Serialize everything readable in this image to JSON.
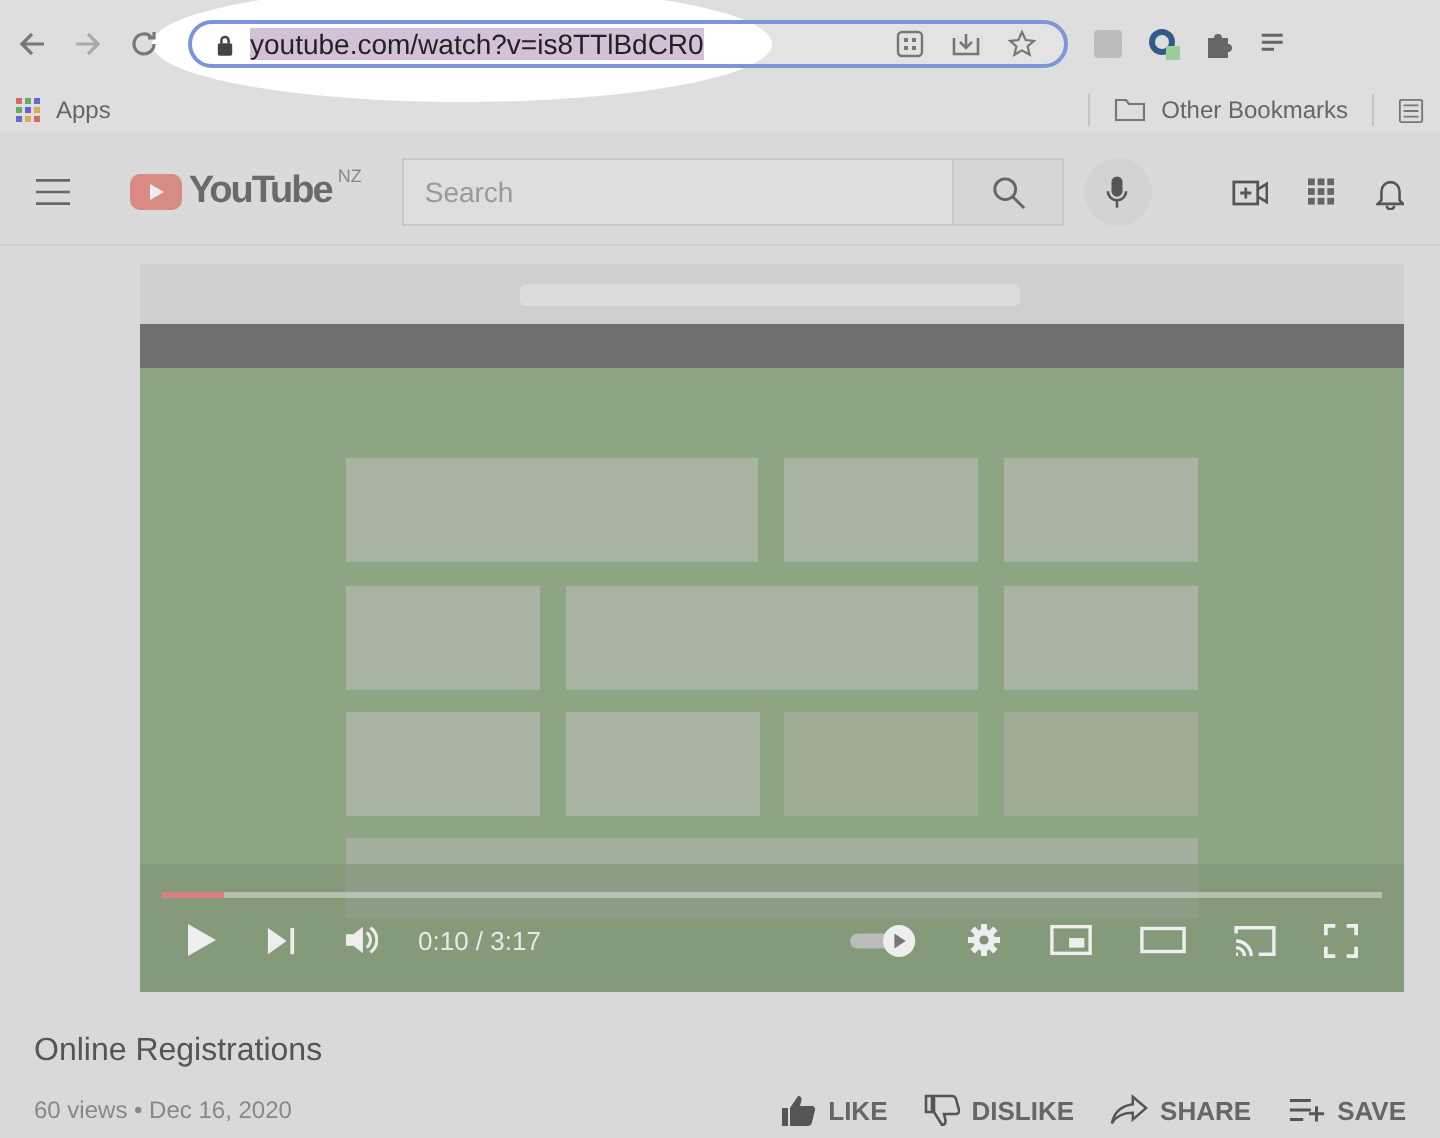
{
  "browser": {
    "url": "youtube.com/watch?v=is8TTlBdCR0",
    "bookmarks": [
      {
        "label": "Apps"
      },
      {
        "label": "Other Bookmarks"
      }
    ]
  },
  "header": {
    "logo": "YouTube",
    "region": "NZ",
    "search": {
      "placeholder": "Search"
    }
  },
  "player": {
    "kind": "picture",
    "time": "0:10 / 3:17",
    "progress": {
      "level": 0.05
    }
  },
  "video": {
    "title": "Online Registrations",
    "meta": "60 views • Dec 16, 2020",
    "actions": [
      {
        "kind": "like",
        "label": "LIKE"
      },
      {
        "kind": "dislike",
        "label": "DISLIKE"
      },
      {
        "kind": "share",
        "label": "SHARE"
      },
      {
        "kind": "save",
        "label": "SAVE"
      }
    ]
  }
}
